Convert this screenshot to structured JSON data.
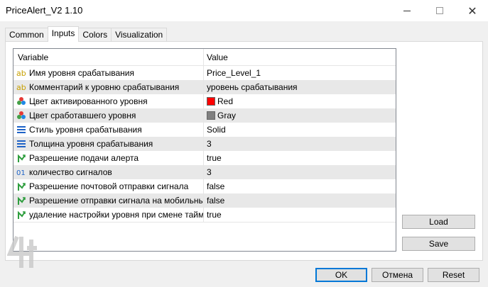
{
  "window": {
    "title": "PriceAlert_V2 1.10"
  },
  "tabs": [
    {
      "label": "Common"
    },
    {
      "label": "Inputs"
    },
    {
      "label": "Colors"
    },
    {
      "label": "Visualization"
    }
  ],
  "grid": {
    "header": {
      "variable": "Variable",
      "value": "Value"
    },
    "rows": [
      {
        "icon": "ab-string-icon",
        "name": "Имя уровня срабатывания",
        "value": "Price_Level_1"
      },
      {
        "icon": "ab-string-icon",
        "name": "Комментарий к уровню срабатывания",
        "value": "уровень срабатывания"
      },
      {
        "icon": "color-palette-icon",
        "name": "Цвет активированного уровня",
        "value": "Red",
        "swatch": "#ff0000"
      },
      {
        "icon": "color-palette-icon",
        "name": "Цвет сработавшего уровня",
        "value": "Gray",
        "swatch": "#808080"
      },
      {
        "icon": "line-style-icon",
        "name": "Стиль уровня срабатывания",
        "value": "Solid"
      },
      {
        "icon": "line-style-icon",
        "name": "Толщина уровня срабатывания",
        "value": "3"
      },
      {
        "icon": "bool-arrow-icon",
        "name": "Разрешение подачи алерта",
        "value": "true"
      },
      {
        "icon": "integer-01-icon",
        "name": "количество сигналов",
        "value": "3"
      },
      {
        "icon": "bool-arrow-icon",
        "name": "Разрешение почтовой отправки сигнала",
        "value": "false"
      },
      {
        "icon": "bool-arrow-icon",
        "name": "Разрешение отправки сигнала на мобильный",
        "value": "false"
      },
      {
        "icon": "bool-arrow-icon",
        "name": "удаление настройки уровня при смене тайм...",
        "value": "true"
      }
    ]
  },
  "buttons": {
    "load": "Load",
    "save": "Save",
    "ok": "OK",
    "cancel": "Отмена",
    "reset": "Reset"
  },
  "colors": {
    "ok_border": "#0078d7",
    "red": "#ff0000",
    "gray": "#808080"
  }
}
